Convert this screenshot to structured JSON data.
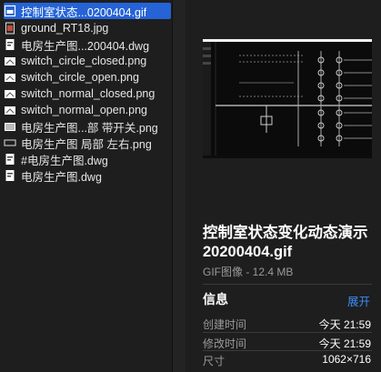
{
  "files": [
    {
      "label": "控制室状态...0200404.gif",
      "icon": "gif-file-icon",
      "selected": true
    },
    {
      "label": "ground_RT18.jpg",
      "icon": "jpg-file-icon"
    },
    {
      "label": "电房生产图...200404.dwg",
      "icon": "dwg-file-icon"
    },
    {
      "label": "switch_circle_closed.png",
      "icon": "png-file-icon"
    },
    {
      "label": "switch_circle_open.png",
      "icon": "png-file-icon"
    },
    {
      "label": "switch_normal_closed.png",
      "icon": "png-file-icon"
    },
    {
      "label": "switch_normal_open.png",
      "icon": "png-file-icon"
    },
    {
      "label": "电房生产图...部 带开关.png",
      "icon": "png-file-icon"
    },
    {
      "label": "电房生产图 局部 左右.png",
      "icon": "png-file-icon"
    },
    {
      "label": "#电房生产图.dwg",
      "icon": "dwg-file-icon"
    },
    {
      "label": "电房生产图.dwg",
      "icon": "dwg-file-icon"
    }
  ],
  "preview": {
    "filename": "控制室状态变化动态演示20200404.gif",
    "kind": "GIF图像 - 12.4 MB"
  },
  "info": {
    "title": "信息",
    "expand_label": "展开",
    "rows": [
      {
        "key": "创建时间",
        "value": "今天 21:59"
      },
      {
        "key": "修改时间",
        "value": "今天 21:59"
      },
      {
        "key": "尺寸",
        "value": "1062×716"
      }
    ]
  }
}
